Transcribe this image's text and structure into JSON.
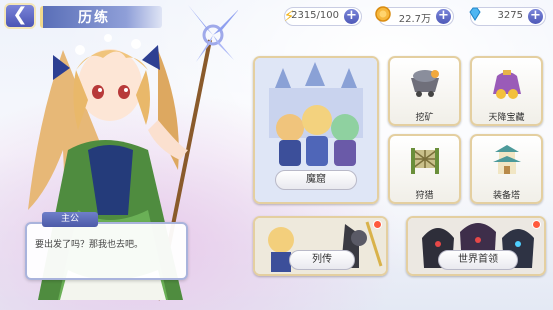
{
  "header": {
    "back_icon": "back-arrow-icon",
    "title": "历练"
  },
  "resources": {
    "stamina": {
      "icon": "lightning-icon",
      "value": "2315/100"
    },
    "gold": {
      "icon": "gold-coin-icon",
      "value": "22.7万"
    },
    "diamond": {
      "icon": "diamond-icon",
      "value": "3275"
    }
  },
  "dialog": {
    "speaker": "主公",
    "text": "要出发了吗？那我也去吧。"
  },
  "modes": {
    "dungeon": {
      "label": "魔窟"
    },
    "mining": {
      "label": "挖矿",
      "icon": "minecart-icon"
    },
    "treasure": {
      "label": "天降宝藏",
      "icon": "treasure-bag-icon"
    },
    "hunting": {
      "label": "狩猎",
      "icon": "hunting-net-icon"
    },
    "equip_tower": {
      "label": "装备塔",
      "icon": "pagoda-tower-icon"
    },
    "biography": {
      "label": "列传"
    },
    "world_boss": {
      "label": "世界首领"
    }
  },
  "colors": {
    "accent": "#5a68c0",
    "card_border": "#e4cfa0",
    "badge": "#ff5a3c"
  }
}
